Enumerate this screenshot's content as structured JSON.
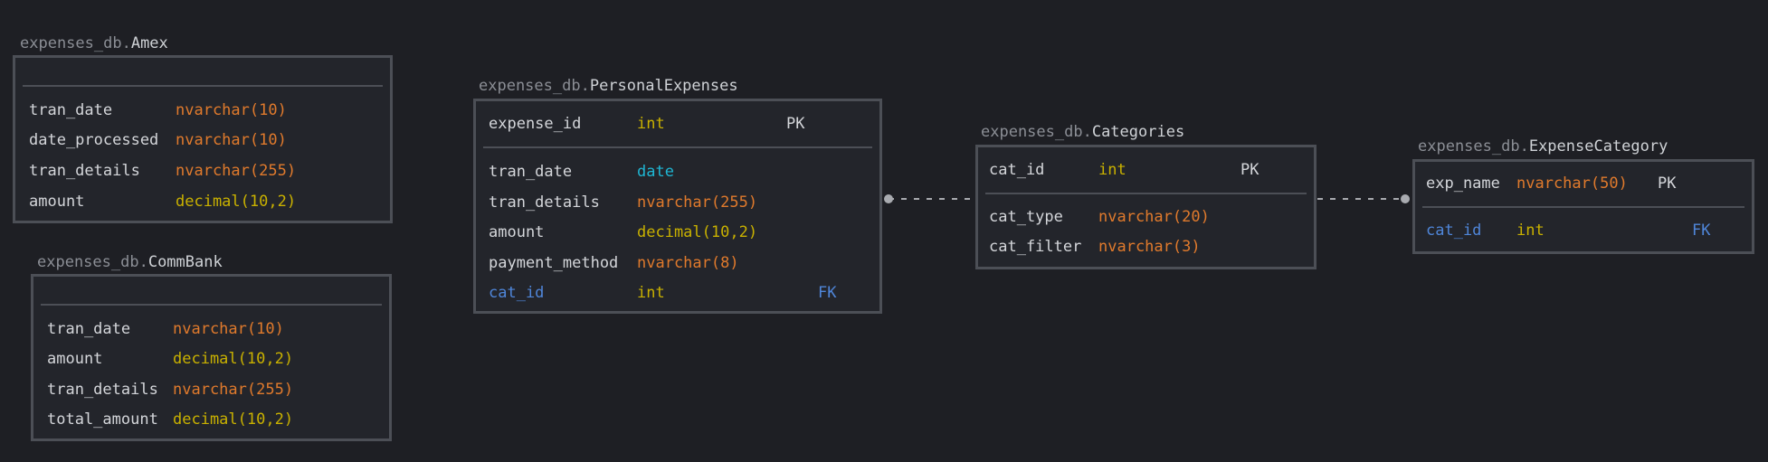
{
  "tables": {
    "amex": {
      "schema": "expenses_db.",
      "name": "Amex",
      "columns": [
        {
          "name": "tran_date",
          "type": "nvarchar(10)",
          "type_color": "#e07a2c"
        },
        {
          "name": "date_processed",
          "type": "nvarchar(10)",
          "type_color": "#e07a2c"
        },
        {
          "name": "tran_details",
          "type": "nvarchar(255)",
          "type_color": "#e07a2c"
        },
        {
          "name": "amount",
          "type": "decimal(10,2)",
          "type_color": "#c9b100"
        }
      ]
    },
    "commbank": {
      "schema": "expenses_db.",
      "name": "CommBank",
      "columns": [
        {
          "name": "tran_date",
          "type": "nvarchar(10)",
          "type_color": "#e07a2c"
        },
        {
          "name": "amount",
          "type": "decimal(10,2)",
          "type_color": "#c9b100"
        },
        {
          "name": "tran_details",
          "type": "nvarchar(255)",
          "type_color": "#e07a2c"
        },
        {
          "name": "total_amount",
          "type": "decimal(10,2)",
          "type_color": "#c9b100"
        }
      ]
    },
    "personal_expenses": {
      "schema": "expenses_db.",
      "name": "PersonalExpenses",
      "pk": {
        "name": "expense_id",
        "type": "int",
        "key": "PK"
      },
      "columns": [
        {
          "name": "tran_date",
          "type": "date",
          "type_color": "#1fb6d3"
        },
        {
          "name": "tran_details",
          "type": "nvarchar(255)",
          "type_color": "#e07a2c"
        },
        {
          "name": "amount",
          "type": "decimal(10,2)",
          "type_color": "#c9b100"
        },
        {
          "name": "payment_method",
          "type": "nvarchar(8)",
          "type_color": "#e07a2c"
        },
        {
          "name": "cat_id",
          "type": "int",
          "type_color": "#c9b100",
          "key": "FK"
        }
      ]
    },
    "categories": {
      "schema": "expenses_db.",
      "name": "Categories",
      "pk": {
        "name": "cat_id",
        "type": "int",
        "key": "PK"
      },
      "columns": [
        {
          "name": "cat_type",
          "type": "nvarchar(20)",
          "type_color": "#e07a2c"
        },
        {
          "name": "cat_filter",
          "type": "nvarchar(3)",
          "type_color": "#e07a2c"
        }
      ]
    },
    "expense_category": {
      "schema": "expenses_db.",
      "name": "ExpenseCategory",
      "pk": {
        "name": "exp_name",
        "type": "nvarchar(50)",
        "type_color": "#e07a2c",
        "key": "PK"
      },
      "columns": [
        {
          "name": "cat_id",
          "type": "int",
          "type_color": "#c9b100",
          "key": "FK"
        }
      ]
    }
  },
  "colors": {
    "background": "#1e1f24",
    "border": "#4c4f56",
    "fk": "#4f86d9",
    "connector": "#a9abb0"
  }
}
